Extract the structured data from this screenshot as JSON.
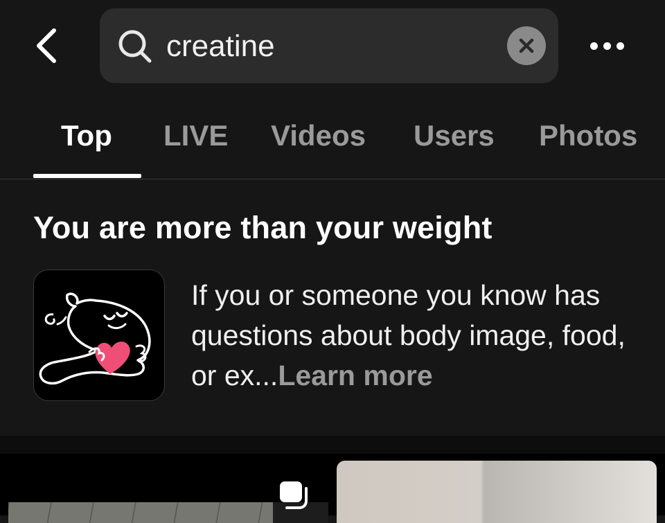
{
  "search": {
    "query": "creatine"
  },
  "tabs": [
    {
      "label": "Top",
      "active": true
    },
    {
      "label": "LIVE",
      "active": false
    },
    {
      "label": "Videos",
      "active": false
    },
    {
      "label": "Users",
      "active": false
    },
    {
      "label": "Photos",
      "active": false
    }
  ],
  "notice": {
    "title": "You are more than your weight",
    "body": "If you or someone you know has questions about body image, food, or ex...",
    "learn_more": "Learn more"
  },
  "colors": {
    "background": "#161616",
    "search_bg": "#2c2c2c",
    "heart": "#ef4f77",
    "inactive_tab": "#9a9a9a"
  },
  "icons": {
    "back": "back-chevron-icon",
    "search": "search-icon",
    "clear": "clear-icon",
    "more": "more-icon",
    "thumbnail": "body-image-heart-illustration",
    "multi_photo": "multi-photo-icon"
  }
}
